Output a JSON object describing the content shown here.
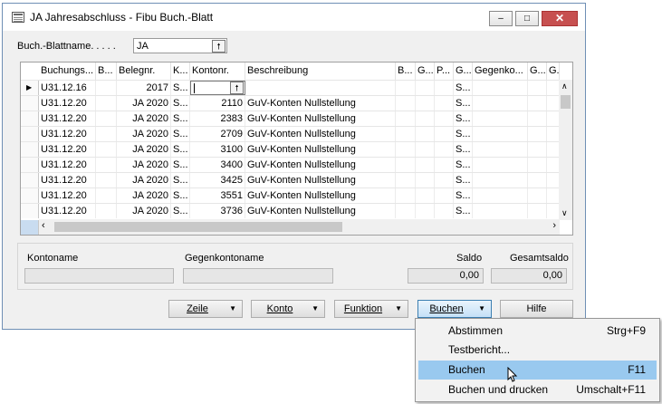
{
  "window": {
    "title": "JA Jahresabschluss - Fibu Buch.-Blatt",
    "minimize": "–",
    "maximize": "□",
    "close": "✕"
  },
  "batch": {
    "label": "Buch.-Blattname. . . . .",
    "value": "JA"
  },
  "columns": [
    "Buchungs...",
    "B...",
    "Belegnr.",
    "K...",
    "Kontonr.",
    "Beschreibung",
    "B...",
    "G...",
    "P...",
    "G...",
    "Gegenko...",
    "G...",
    "G..."
  ],
  "rows": [
    {
      "date": "U31.12.16",
      "doc": "2017",
      "k": "S...",
      "acct": "",
      "desc": "",
      "g": "S...",
      "current": true
    },
    {
      "date": "U31.12.20",
      "doc": "JA 2020",
      "k": "S...",
      "acct": "2110",
      "desc": "GuV-Konten Nullstellung",
      "g": "S..."
    },
    {
      "date": "U31.12.20",
      "doc": "JA 2020",
      "k": "S...",
      "acct": "2383",
      "desc": "GuV-Konten Nullstellung",
      "g": "S..."
    },
    {
      "date": "U31.12.20",
      "doc": "JA 2020",
      "k": "S...",
      "acct": "2709",
      "desc": "GuV-Konten Nullstellung",
      "g": "S..."
    },
    {
      "date": "U31.12.20",
      "doc": "JA 2020",
      "k": "S...",
      "acct": "3100",
      "desc": "GuV-Konten Nullstellung",
      "g": "S..."
    },
    {
      "date": "U31.12.20",
      "doc": "JA 2020",
      "k": "S...",
      "acct": "3400",
      "desc": "GuV-Konten Nullstellung",
      "g": "S..."
    },
    {
      "date": "U31.12.20",
      "doc": "JA 2020",
      "k": "S...",
      "acct": "3425",
      "desc": "GuV-Konten Nullstellung",
      "g": "S..."
    },
    {
      "date": "U31.12.20",
      "doc": "JA 2020",
      "k": "S...",
      "acct": "3551",
      "desc": "GuV-Konten Nullstellung",
      "g": "S..."
    },
    {
      "date": "U31.12.20",
      "doc": "JA 2020",
      "k": "S...",
      "acct": "3736",
      "desc": "GuV-Konten Nullstellung",
      "g": "S..."
    }
  ],
  "footer": {
    "kontoname_label": "Kontoname",
    "gegenkontoname_label": "Gegenkontoname",
    "saldo_label": "Saldo",
    "gesamtsaldo_label": "Gesamtsaldo",
    "saldo_value": "0,00",
    "gesamtsaldo_value": "0,00"
  },
  "buttons": {
    "zeile": "Zeile",
    "konto": "Konto",
    "funktion": "Funktion",
    "buchen": "Buchen",
    "hilfe": "Hilfe"
  },
  "menu": [
    {
      "label": "Abstimmen",
      "shortcut": "Strg+F9"
    },
    {
      "label": "Testbericht...",
      "shortcut": ""
    },
    {
      "label": "Buchen",
      "shortcut": "F11"
    },
    {
      "label": "Buchen und drucken",
      "shortcut": "Umschalt+F11"
    }
  ],
  "icons": {
    "lookup": "lookup-arrow-icon",
    "row_pointer": "row-pointer-icon",
    "dropdown": "chevron-down-icon"
  },
  "colors": {
    "menu_highlight": "#99c9ef",
    "close_button": "#c75050"
  }
}
